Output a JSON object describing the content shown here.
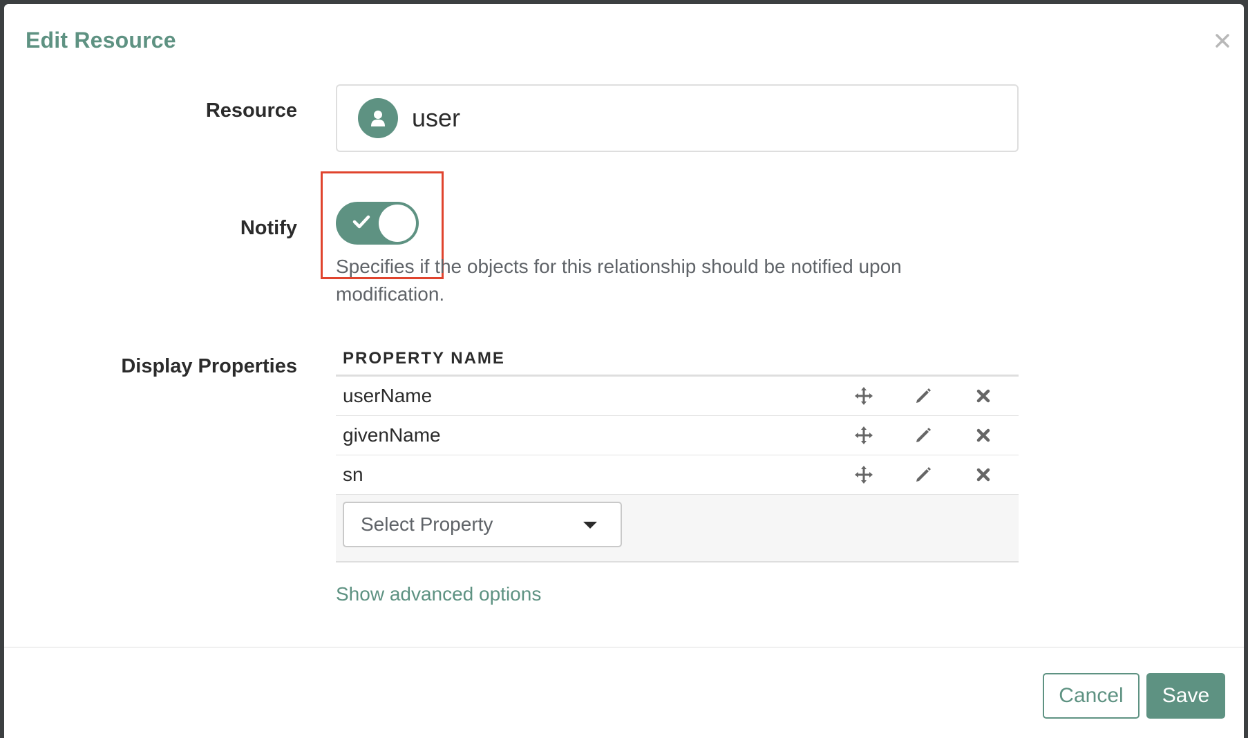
{
  "modal": {
    "title": "Edit Resource"
  },
  "form": {
    "resource_label": "Resource",
    "resource_value": "user",
    "notify_label": "Notify",
    "notify_enabled": true,
    "notify_help": "Specifies if the objects for this relationship should be notified upon modification.",
    "display_properties_label": "Display Properties"
  },
  "table": {
    "header": "PROPERTY NAME",
    "rows": [
      {
        "name": "userName"
      },
      {
        "name": "givenName"
      },
      {
        "name": "sn"
      }
    ],
    "select_placeholder": "Select Property"
  },
  "links": {
    "advanced": "Show advanced options"
  },
  "footer": {
    "cancel_label": "Cancel",
    "save_label": "Save"
  },
  "colors": {
    "accent": "#5e9282",
    "highlight": "#e0442e"
  },
  "icons": {
    "close": "close-icon",
    "user": "user-icon",
    "check": "check-icon",
    "move": "move-icon",
    "edit": "pencil-icon",
    "delete": "delete-icon",
    "dropdown": "caret-down-icon"
  }
}
